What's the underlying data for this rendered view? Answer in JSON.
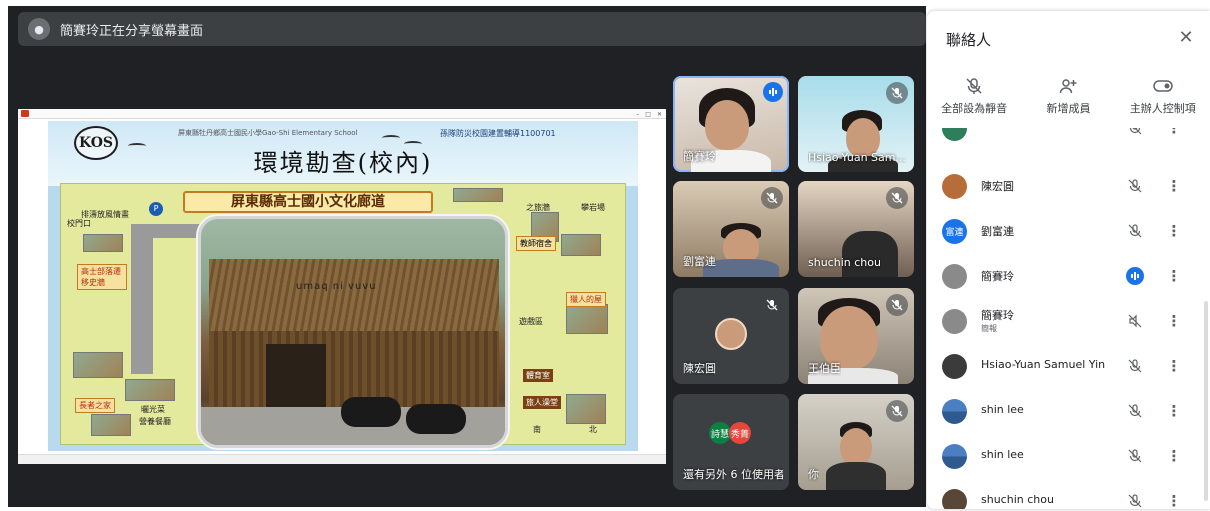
{
  "presenter_bar": {
    "text": "簡賽玲正在分享螢幕畫面"
  },
  "slide": {
    "school": "屏東縣牡丹鄉高士國民小學Gao-Shi Elementary School",
    "subtitle": "孫隊防災校園建置輔導1100701",
    "title": "環境勘查(校內)",
    "banner": "屏東縣高士國小文化廊道",
    "logo": "KOS",
    "photo_sign": "umaq ni vuvu",
    "labels": {
      "drain": "排濤放風情畫",
      "gate": "校門口",
      "tribe": "高士部落遷移史牆",
      "elder": "長者之家",
      "sun": "曬光菜",
      "meal": "營養餐廳",
      "trip": "之旅牆",
      "rock": "攀岩場",
      "teacher": "教師宿舍",
      "play": "遊戲區",
      "hunter": "獵人的屋",
      "gym": "體育室",
      "bath": "旅人澡堂",
      "south": "南",
      "north": "北"
    }
  },
  "tiles": [
    {
      "name": "簡賽玲",
      "speaking": true
    },
    {
      "name": "Hsiao-Yuan Sam..."
    },
    {
      "name": "劉富連"
    },
    {
      "name": "shuchin chou"
    },
    {
      "name": "陳宏圓"
    },
    {
      "name": "王伯臣"
    },
    {
      "name": "還有另外 6 位使用者",
      "avatars": [
        "詩慧",
        "秀菁"
      ]
    },
    {
      "name": "你"
    }
  ],
  "panel": {
    "title": "聯絡人",
    "actions": [
      {
        "label": "全部設為靜音",
        "icon": "mic-off-icon"
      },
      {
        "label": "新增成員",
        "icon": "add-person-icon"
      },
      {
        "label": "主辦人控制項",
        "icon": "toggle-icon"
      }
    ],
    "people": [
      {
        "name": "",
        "avatar_color": "#2e7d5b",
        "mic": "off"
      },
      {
        "name": "陳宏圓",
        "avatar_color": "#b76d3a",
        "mic": "off"
      },
      {
        "name": "劉富連",
        "avatar_text": "富連",
        "avatar_color": "#1a73e8",
        "mic": "off"
      },
      {
        "name": "簡賽玲",
        "avatar_color": "#8a8a8a",
        "mic": "speaking"
      },
      {
        "name": "簡賽玲",
        "sub": "簡報",
        "avatar_color": "#8a8a8a",
        "mic": "presenting"
      },
      {
        "name": "Hsiao-Yuan Samuel Yin",
        "avatar_color": "#3b3b3b",
        "mic": "off"
      },
      {
        "name": "shin lee",
        "avatar_color": "#3f6fb0",
        "mic": "off"
      },
      {
        "name": "shin lee",
        "avatar_color": "#3f6fb0",
        "mic": "off"
      },
      {
        "name": "shuchin chou",
        "avatar_color": "#5a4636",
        "mic": "off"
      }
    ]
  },
  "colors": {
    "stage": "#202124",
    "tile": "#3c4043",
    "accent": "#1a73e8",
    "speaking_outline": "#8ab4f8"
  }
}
